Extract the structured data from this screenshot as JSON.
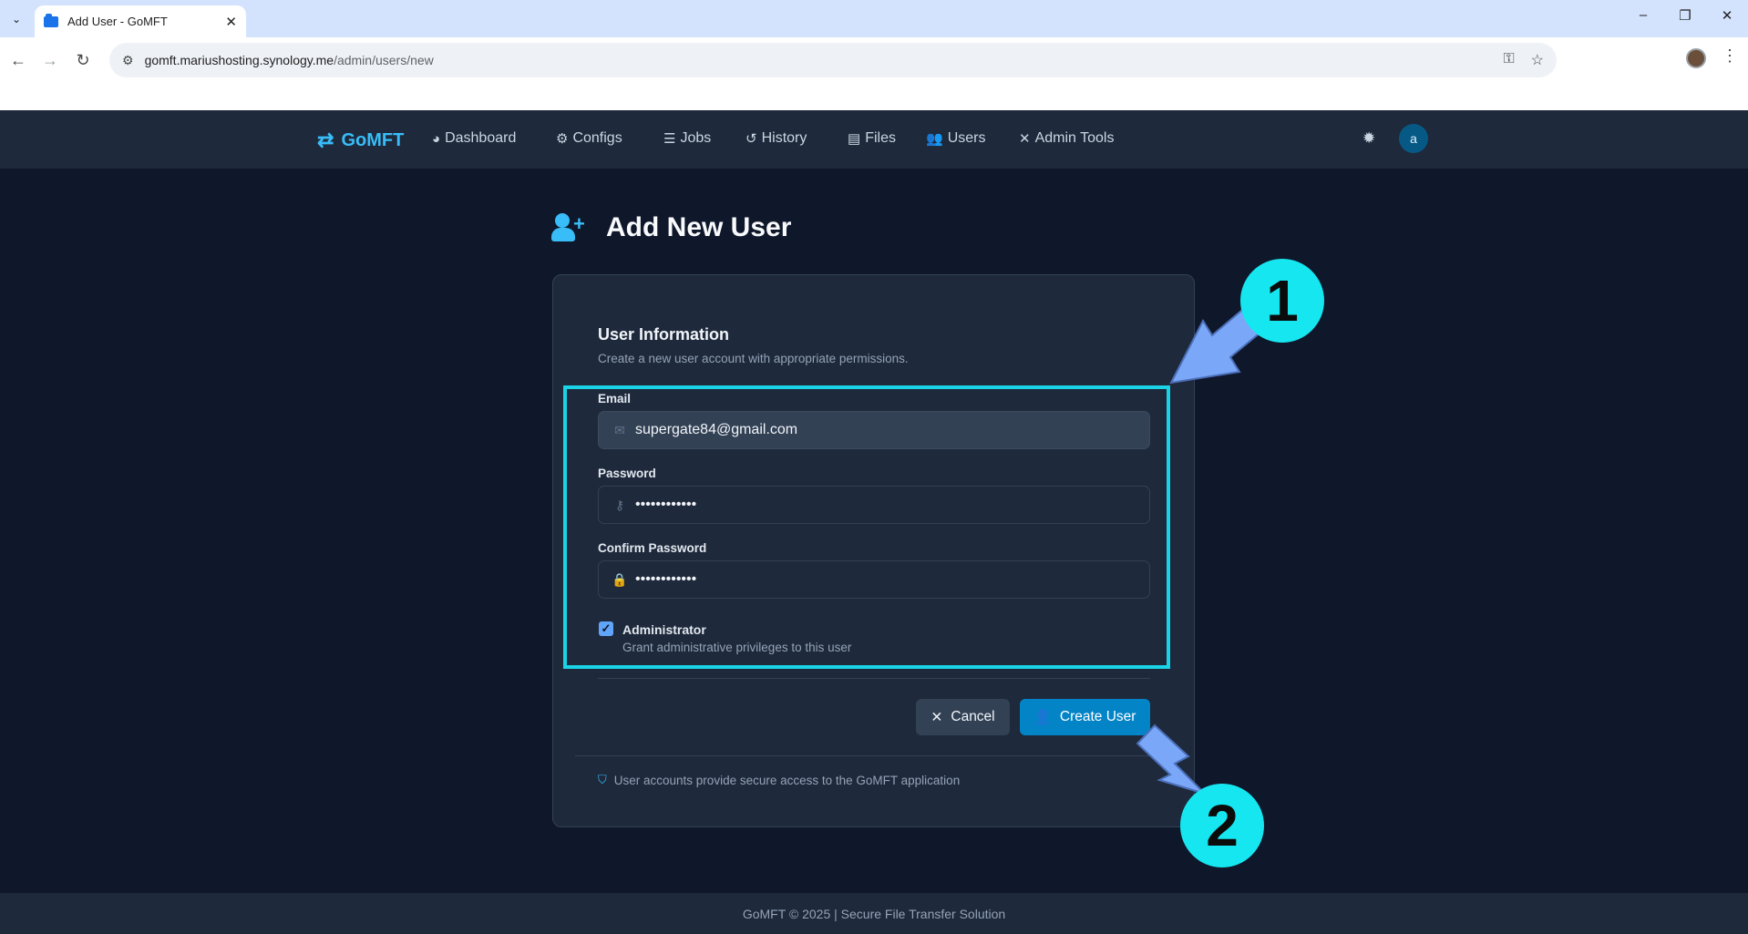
{
  "browser": {
    "tab_title": "Add User - GoMFT",
    "url_host": "gomft.mariushosting.synology.me",
    "url_path": "/admin/users/new"
  },
  "navbar": {
    "brand": "GoMFT",
    "items": [
      {
        "label": "Dashboard",
        "icon": "dashboard-icon"
      },
      {
        "label": "Configs",
        "icon": "cogs-icon"
      },
      {
        "label": "Jobs",
        "icon": "list-icon"
      },
      {
        "label": "History",
        "icon": "history-icon"
      },
      {
        "label": "Files",
        "icon": "file-icon"
      },
      {
        "label": "Users",
        "icon": "users-icon"
      },
      {
        "label": "Admin Tools",
        "icon": "tools-icon"
      }
    ],
    "avatar_initial": "a"
  },
  "page": {
    "title": "Add New User"
  },
  "form": {
    "section_title": "User Information",
    "section_subtitle": "Create a new user account with appropriate permissions.",
    "email_label": "Email",
    "email_value": "supergate84@gmail.com",
    "password_label": "Password",
    "password_value": "••••••••••••",
    "confirm_label": "Confirm Password",
    "confirm_value": "••••••••••••",
    "admin_label": "Administrator",
    "admin_desc": "Grant administrative privileges to this user",
    "admin_checked": true,
    "cancel_label": "Cancel",
    "create_label": "Create User",
    "footnote": "User accounts provide secure access to the GoMFT application"
  },
  "footer": {
    "text": "GoMFT © 2025 | Secure File Transfer Solution"
  },
  "annotations": {
    "badge_1": "1",
    "badge_2": "2",
    "highlight_color": "#1ad3e6",
    "arrow_color": "#7aa7f7"
  },
  "colors": {
    "accent": "#38bdf8",
    "primary_button": "#0284c7",
    "background": "#0f172a",
    "card": "#1e293b"
  }
}
